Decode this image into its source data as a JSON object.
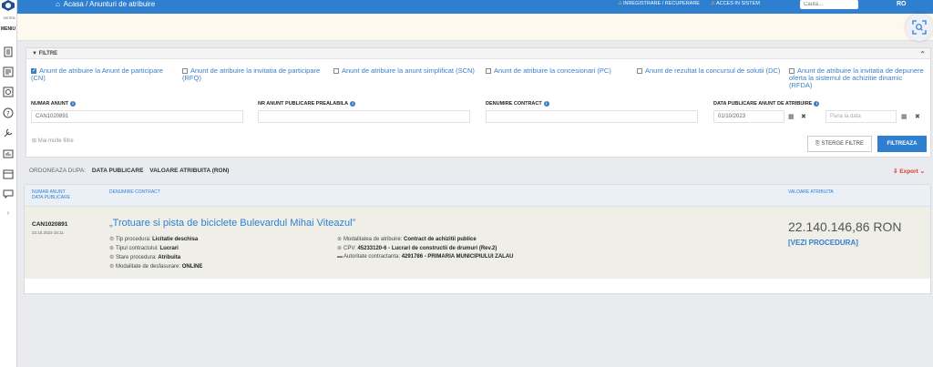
{
  "sidebar": {
    "system_label": "SISTEM",
    "menu_label": "MENIU",
    "expand_icon": "›"
  },
  "header": {
    "home_icon": "⌂",
    "breadcrumb": [
      "Acasa",
      "Anunturi de atribuire"
    ],
    "link_register": "INREGISTRARE / RECUPERARE",
    "link_login": "ACCES IN SISTEM",
    "search_placeholder": "Cauta...",
    "lang": "RO"
  },
  "filters": {
    "title": "FILTRE",
    "collapse_icon": "⌃",
    "checkboxes": [
      {
        "label": "Anunt de atribuire la Anunt de participare (CN)",
        "checked": true
      },
      {
        "label": "Anunt de atribuire la invitatia de participare (RFQ)",
        "checked": false
      },
      {
        "label": "Anunt de atribuire la anunt simplificat (SCN)",
        "checked": false
      },
      {
        "label": "Anunt de atribuire la concesionari (PC)",
        "checked": false
      },
      {
        "label": "Anunt de rezultat la concursul de solutii (DC)",
        "checked": false
      },
      {
        "label": "Anunt de atribuire la invitatia de depunere oferta la sistemul de achizitie dinamic (RFDA)",
        "checked": false
      }
    ],
    "fields": {
      "numar_anunt_label": "NUMAR ANUNT",
      "numar_anunt_value": "CAN1020891",
      "nr_prealabila_label": "NR ANUNT PUBLICARE PREALABILA",
      "denumire_contract_label": "DENUMIRE CONTRACT",
      "data_publicare_label": "DATA PUBLICARE ANUNT DE ATRIBUIRE",
      "data_from": "01/10/2023",
      "data_to_placeholder": "Pana la data",
      "info_icon": "i",
      "calendar_icon": "▦",
      "clear_icon": "✖"
    },
    "more_filters": "⊞ Mai multe filtre",
    "clear_button": "⎘ STERGE FILTRE",
    "filter_button": "FILTREAZA"
  },
  "sort": {
    "label": "ORDONEAZA DUPA:",
    "options": [
      "DATA PUBLICARE",
      "VALOARE ATRIBUITA (RON)"
    ],
    "export": "⇩ Export ⌄"
  },
  "results": {
    "headers": {
      "col1_line1": "NUMAR ANUNT",
      "col1_line2": "DATA PUBLICARE",
      "col2": "DENUMIRE CONTRACT",
      "col3": "VALOARE ATRIBUITA"
    },
    "rows": [
      {
        "number": "CAN1020891",
        "date": "23.10.2023 15:11",
        "title": "„Trotuare si pista de biciclete Bulevardul Mihai Viteazul”",
        "left_meta": [
          {
            "icon": "⚙",
            "label": "Tip procedura:",
            "value": "Licitatie deschisa"
          },
          {
            "icon": "⊕",
            "label": "Tipul contractului:",
            "value": "Lucrari"
          },
          {
            "icon": "⚙",
            "label": "Stare procedura:",
            "value": "Atribuita"
          },
          {
            "icon": "⚙",
            "label": "Modalitate de desfasurare:",
            "value": "ONLINE"
          }
        ],
        "right_meta": [
          {
            "icon": "⊕",
            "label": "Modalitatea de atribuire:",
            "value": "Contract de achizitii publice"
          },
          {
            "icon": "⊕",
            "label": "CPV:",
            "value": "45233120-6 - Lucrari de constructii de drumuri (Rev.2)"
          },
          {
            "icon": "▬",
            "label": "Autoritate contractanta:",
            "value": "4291786 - PRIMARIA MUNICIPIULUI ZALAU"
          }
        ],
        "value": "22.140.146,86",
        "currency": "RON",
        "view_link": "[VEZI PROCEDURA]"
      }
    ]
  },
  "colors": {
    "primary": "#2f7fd0",
    "danger": "#d9412e"
  }
}
